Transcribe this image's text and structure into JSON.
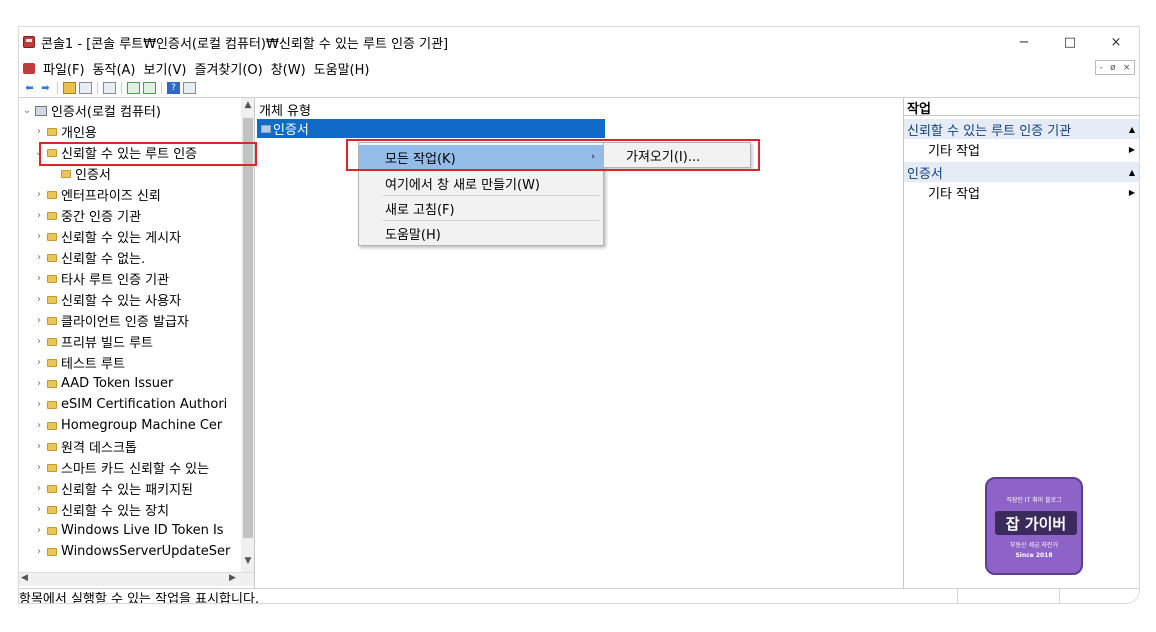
{
  "window": {
    "title": "콘솔1 - [콘솔 루트₩인증서(로컬 컴퓨터)₩신뢰할 수 있는 루트 인증 기관]",
    "controls": {
      "minimize": "−",
      "maximize": "□",
      "close": "×"
    }
  },
  "menubar": {
    "items": [
      "파일(F)",
      "동작(A)",
      "보기(V)",
      "즐겨찾기(O)",
      "창(W)",
      "도움말(H)"
    ],
    "child_controls": [
      "-",
      "ø",
      "×"
    ]
  },
  "toolbar": {
    "icons": [
      "back-arrow-icon",
      "forward-arrow-icon",
      "up-folder-icon",
      "show-hide-tree-icon",
      "clipboard-icon",
      "refresh-icon",
      "export-list-icon",
      "help-icon",
      "properties-icon"
    ],
    "glyphs": {
      "back": "⬅",
      "forward": "➡",
      "help": "?"
    }
  },
  "tree": {
    "root_label": "인증서(로컬 컴퓨터)",
    "items": [
      {
        "label": "개인용",
        "expanded": false,
        "level": 1
      },
      {
        "label": "신뢰할 수 있는 루트 인증",
        "expanded": true,
        "level": 1
      },
      {
        "label": "인증서",
        "expanded": false,
        "level": 2
      },
      {
        "label": "엔터프라이즈 신뢰",
        "expanded": false,
        "level": 1
      },
      {
        "label": "중간 인증 기관",
        "expanded": false,
        "level": 1
      },
      {
        "label": "신뢰할 수 있는 게시자",
        "expanded": false,
        "level": 1
      },
      {
        "label": "신뢰할 수 없는.",
        "expanded": false,
        "level": 1
      },
      {
        "label": "타사 루트 인증 기관",
        "expanded": false,
        "level": 1
      },
      {
        "label": "신뢰할 수 있는 사용자",
        "expanded": false,
        "level": 1
      },
      {
        "label": "클라이언트 인증 발급자",
        "expanded": false,
        "level": 1
      },
      {
        "label": "프리뷰 빌드 루트",
        "expanded": false,
        "level": 1
      },
      {
        "label": "테스트 루트",
        "expanded": false,
        "level": 1
      },
      {
        "label": "AAD Token Issuer",
        "expanded": false,
        "level": 1
      },
      {
        "label": "eSIM Certification Authori",
        "expanded": false,
        "level": 1
      },
      {
        "label": "Homegroup Machine Cer",
        "expanded": false,
        "level": 1
      },
      {
        "label": "원격 데스크톱",
        "expanded": false,
        "level": 1
      },
      {
        "label": "스마트 카드 신뢰할 수 있는",
        "expanded": false,
        "level": 1
      },
      {
        "label": "신뢰할 수 있는 패키지된 ",
        "expanded": false,
        "level": 1
      },
      {
        "label": "신뢰할 수 있는 장치",
        "expanded": false,
        "level": 1
      },
      {
        "label": "Windows Live ID Token Is",
        "expanded": false,
        "level": 1
      },
      {
        "label": "WindowsServerUpdateSer",
        "expanded": false,
        "level": 1
      }
    ]
  },
  "middle": {
    "column_header": "개체 유형",
    "rows": [
      "인증서"
    ]
  },
  "context_menu": {
    "items": [
      "모든 작업(K)",
      "여기에서 창 새로 만들기(W)",
      "새로 고침(F)",
      "도움말(H)"
    ],
    "highlighted_index": 0,
    "submenu_item": "가져오기(I)..."
  },
  "actions": {
    "header": "작업",
    "groups": [
      {
        "title": "신뢰할 수 있는 루트 인증 기관",
        "items": [
          "기타 작업"
        ]
      },
      {
        "title": "인증서",
        "items": [
          "기타 작업"
        ]
      }
    ]
  },
  "status": {
    "text": "항목에서 실행할 수 있는 작업을 표시합니다."
  },
  "watermark": {
    "top": "직장인 IT 취미 블로그",
    "main": "잡 가이버",
    "sub": "부동산 세금 자린거",
    "since": "Since 2018"
  },
  "colors": {
    "selection": "#0f6bc6",
    "highlight_outline": "#e0242a",
    "menu_highlight": "#93bde8",
    "badge": "#8e63c8"
  }
}
